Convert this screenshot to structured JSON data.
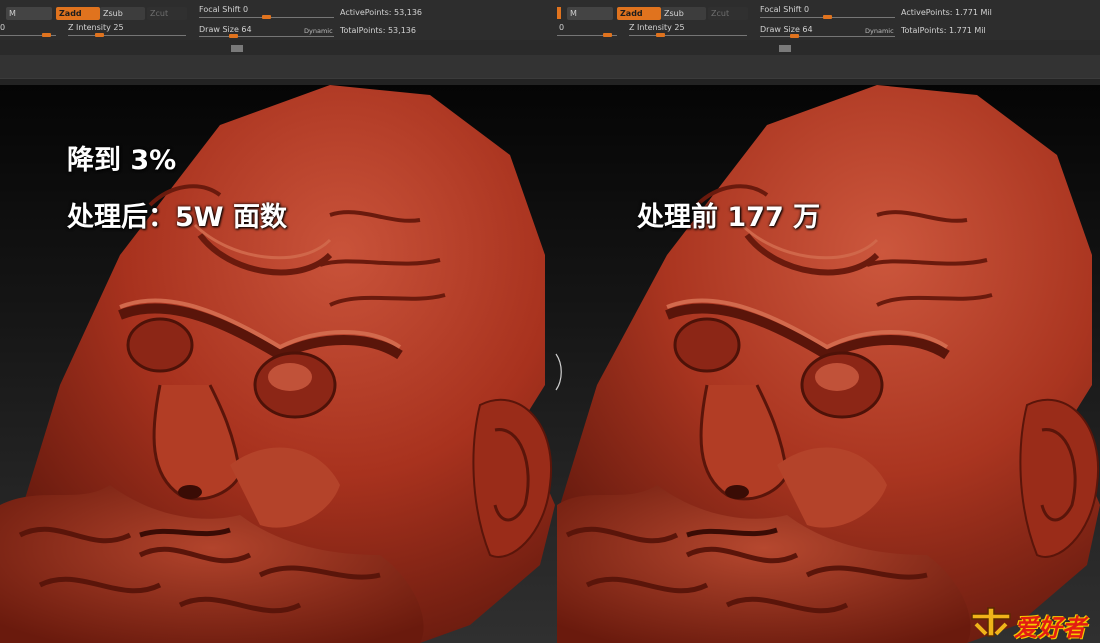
{
  "left_pane": {
    "toolbar": {
      "m_label": "M",
      "zadd_label": "Zadd",
      "zsub_label": "Zsub",
      "zcut_label": "Zcut",
      "rgb_value": "0",
      "z_intensity_label": "Z Intensity",
      "z_intensity_value": "25",
      "z_intensity_level": 0.25,
      "focal_shift_label": "Focal Shift",
      "focal_shift_value": "0",
      "focal_shift_level": 0.5,
      "draw_size_label": "Draw Size",
      "draw_size_value": "64",
      "dynamic_label": "Dynamic",
      "active_points_label": "ActivePoints:",
      "active_points_value": "53,136",
      "total_points_label": "TotalPoints:",
      "total_points_value": "53,136"
    },
    "overlay": {
      "line1": "降到 3%",
      "line2": "处理后：5W 面数"
    }
  },
  "right_pane": {
    "toolbar": {
      "m_label": "M",
      "zadd_label": "Zadd",
      "zsub_label": "Zsub",
      "zcut_label": "Zcut",
      "rgb_value": "0",
      "z_intensity_label": "Z Intensity",
      "z_intensity_value": "25",
      "z_intensity_level": 0.25,
      "focal_shift_label": "Focal Shift",
      "focal_shift_value": "0",
      "focal_shift_level": 0.5,
      "draw_size_label": "Draw Size",
      "draw_size_value": "64",
      "dynamic_label": "Dynamic",
      "active_points_label": "ActivePoints:",
      "active_points_value": "1.771 Mil",
      "total_points_label": "TotalPoints:",
      "total_points_value": "1.771 Mil"
    },
    "overlay": {
      "line1": "处理前 177 万"
    }
  },
  "watermark": {
    "icon": "carpenter-logo-icon",
    "text": "爱好者"
  },
  "colors": {
    "accent": "#e0731e",
    "toolbar_bg": "#2d2d2d",
    "model": "#a8321e"
  }
}
